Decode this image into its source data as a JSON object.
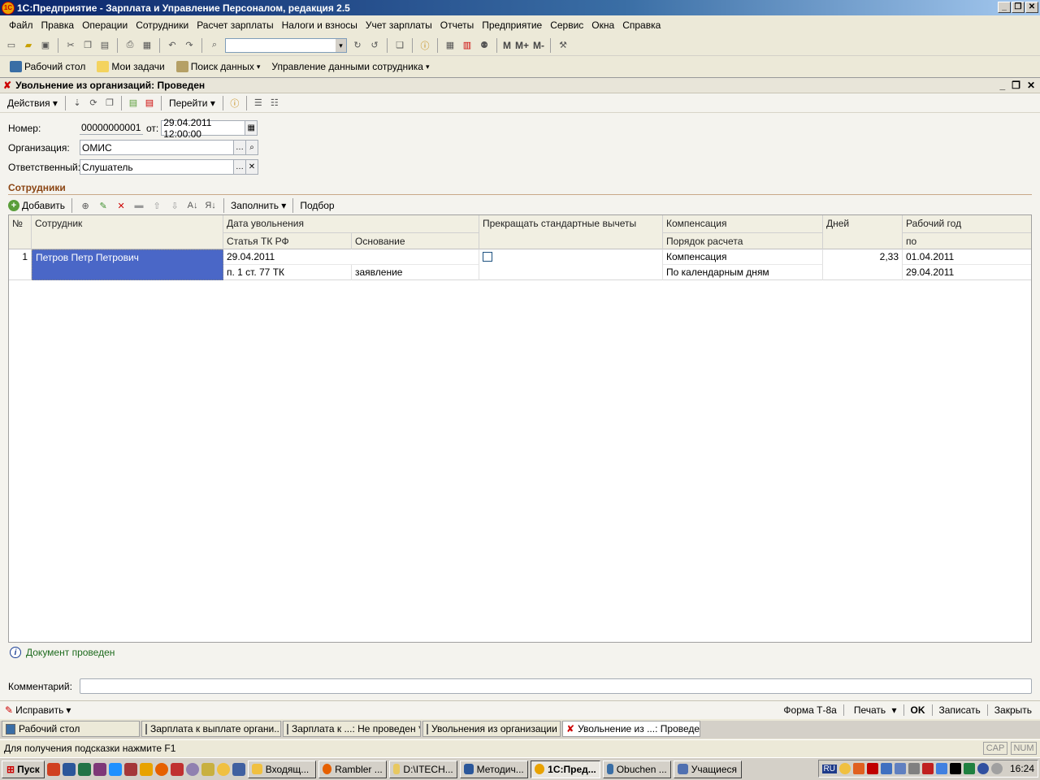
{
  "app": {
    "title": "1С:Предприятие - Зарплата и Управление Персоналом, редакция 2.5",
    "logo": "1С"
  },
  "menu": [
    "Файл",
    "Правка",
    "Операции",
    "Сотрудники",
    "Расчет зарплаты",
    "Налоги и взносы",
    "Учет зарплаты",
    "Отчеты",
    "Предприятие",
    "Сервис",
    "Окна",
    "Справка"
  ],
  "toolbar1": {
    "buttons": [
      "new-icon",
      "open-icon",
      "save-icon",
      "cut-icon",
      "copy-icon",
      "paste-icon",
      "print-icon",
      "preview-icon",
      "undo-icon",
      "redo-icon",
      "find-icon"
    ],
    "search_value": "",
    "mem_buttons": [
      "M",
      "M+",
      "M-"
    ]
  },
  "toolbar2": {
    "items": [
      "Рабочий стол",
      "Мои задачи",
      "Поиск данных",
      "Управление данными сотрудника"
    ]
  },
  "document": {
    "title": "Увольнение из организаций: Проведен",
    "actions_label": "Действия",
    "goto_label": "Перейти",
    "number_label": "Номер:",
    "number_value": "00000000001",
    "date_label": "от:",
    "date_value": "29.04.2011 12:00:00",
    "org_label": "Организация:",
    "org_value": "ОМИС",
    "resp_label": "Ответственный:",
    "resp_value": "Слушатель",
    "section_title": "Сотрудники",
    "table_toolbar": {
      "add_label": "Добавить",
      "fill_label": "Заполнить",
      "select_label": "Подбор"
    },
    "columns": {
      "num": "№",
      "employee": "Сотрудник",
      "dismissal_date": "Дата увольнения",
      "article": "Статья ТК РФ",
      "basis": "Основание",
      "stop_deductions": "Прекращать стандартные вычеты",
      "compensation": "Компенсация",
      "calc_order": "Порядок расчета",
      "days": "Дней",
      "work_year": "Рабочий год",
      "work_year_to": "по"
    },
    "rows": [
      {
        "num": "1",
        "employee": "Петров Петр Петрович",
        "dismissal_date": "29.04.2011",
        "article": "п. 1 ст. 77 ТК",
        "basis": "заявление",
        "stop_deductions": false,
        "compensation": "Компенсация",
        "calc_order": "По календарным дням",
        "days": "2,33",
        "work_year_from": "01.04.2011",
        "work_year_to": "29.04.2011"
      }
    ],
    "status_text": "Документ проведен",
    "comment_label": "Комментарий:",
    "comment_value": "",
    "bottom": {
      "fix_label": "Исправить",
      "form_label": "Форма Т-8а",
      "print_label": "Печать",
      "ok_label": "OK",
      "save_label": "Записать",
      "close_label": "Закрыть"
    }
  },
  "window_tabs": [
    "Рабочий стол",
    "Зарплата к выплате органи...",
    "Зарплата к ...: Не проведен *",
    "Увольнения из организации",
    "Увольнение из ...: Проведен"
  ],
  "hint": {
    "text": "Для получения подсказки нажмите F1",
    "cap": "CAP",
    "num": "NUM"
  },
  "taskbar": {
    "start": "Пуск",
    "tasks": [
      "Входящ...",
      "Rambler ...",
      "D:\\ITECH...",
      "Методич...",
      "1С:Пред...",
      "Obuchen ...",
      "Учащиеся"
    ],
    "lang": "RU",
    "clock": "16:24"
  },
  "colors": {
    "selection": "#4A67C7",
    "section_title": "#8B4513",
    "status_green": "#1E6B1E"
  }
}
